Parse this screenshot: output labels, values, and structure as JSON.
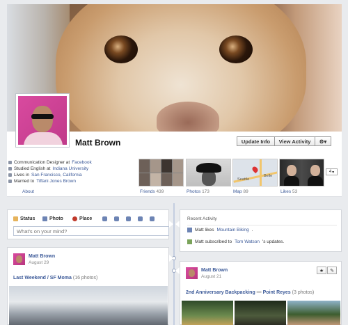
{
  "profile": {
    "name": "Matt Brown",
    "buttons": {
      "update_info": "Update Info",
      "view_activity": "View Activity",
      "gear": "⚙▾"
    },
    "info": [
      {
        "prefix": "Communication Designer at ",
        "link": "Facebook",
        "icon": "briefcase-icon"
      },
      {
        "prefix": "Studied English at ",
        "link": "Indiana University",
        "icon": "education-icon"
      },
      {
        "prefix": "Lives in ",
        "link": "San Francisco, California",
        "icon": "home-icon"
      },
      {
        "prefix": "Married to ",
        "link": "Tiffani Jones Brown",
        "icon": "heart-icon"
      }
    ],
    "about": "About",
    "tiles": [
      {
        "label": "Friends",
        "count": "439"
      },
      {
        "label": "Photos",
        "count": "173"
      },
      {
        "label": "Map",
        "count": "89"
      },
      {
        "label": "Likes",
        "count": "53"
      }
    ],
    "more_count": "4",
    "map_labels": {
      "city": "Seattle",
      "suffix": "Belle"
    }
  },
  "composer": {
    "tabs": {
      "status": "Status",
      "photo": "Photo",
      "place": "Place"
    },
    "placeholder": "What's on your mind?"
  },
  "recent_activity": {
    "title": "Recent Activity",
    "items": [
      {
        "prefix": "Matt likes ",
        "link": "Mountain Biking",
        "suffix": "."
      },
      {
        "prefix": "Matt subscribed to ",
        "link": "Tom Watson",
        "suffix": "'s updates."
      }
    ]
  },
  "posts": [
    {
      "author": "Matt Brown",
      "date": "August 29",
      "link1": "Last Weekend",
      "sep": " / ",
      "link2": "SF Moma",
      "extra": " (16 photos)"
    },
    {
      "author": "Matt Brown",
      "date": "August 21",
      "link1": "2nd Anniversary Backpacking",
      "sep": " — ",
      "link2": "Point Reyes",
      "extra": " (3 photos)",
      "star": "★",
      "edit": "✎"
    }
  ],
  "colors": {
    "link": "#3b5998",
    "background": "#e9ebee",
    "spine": "#c4cde0"
  }
}
